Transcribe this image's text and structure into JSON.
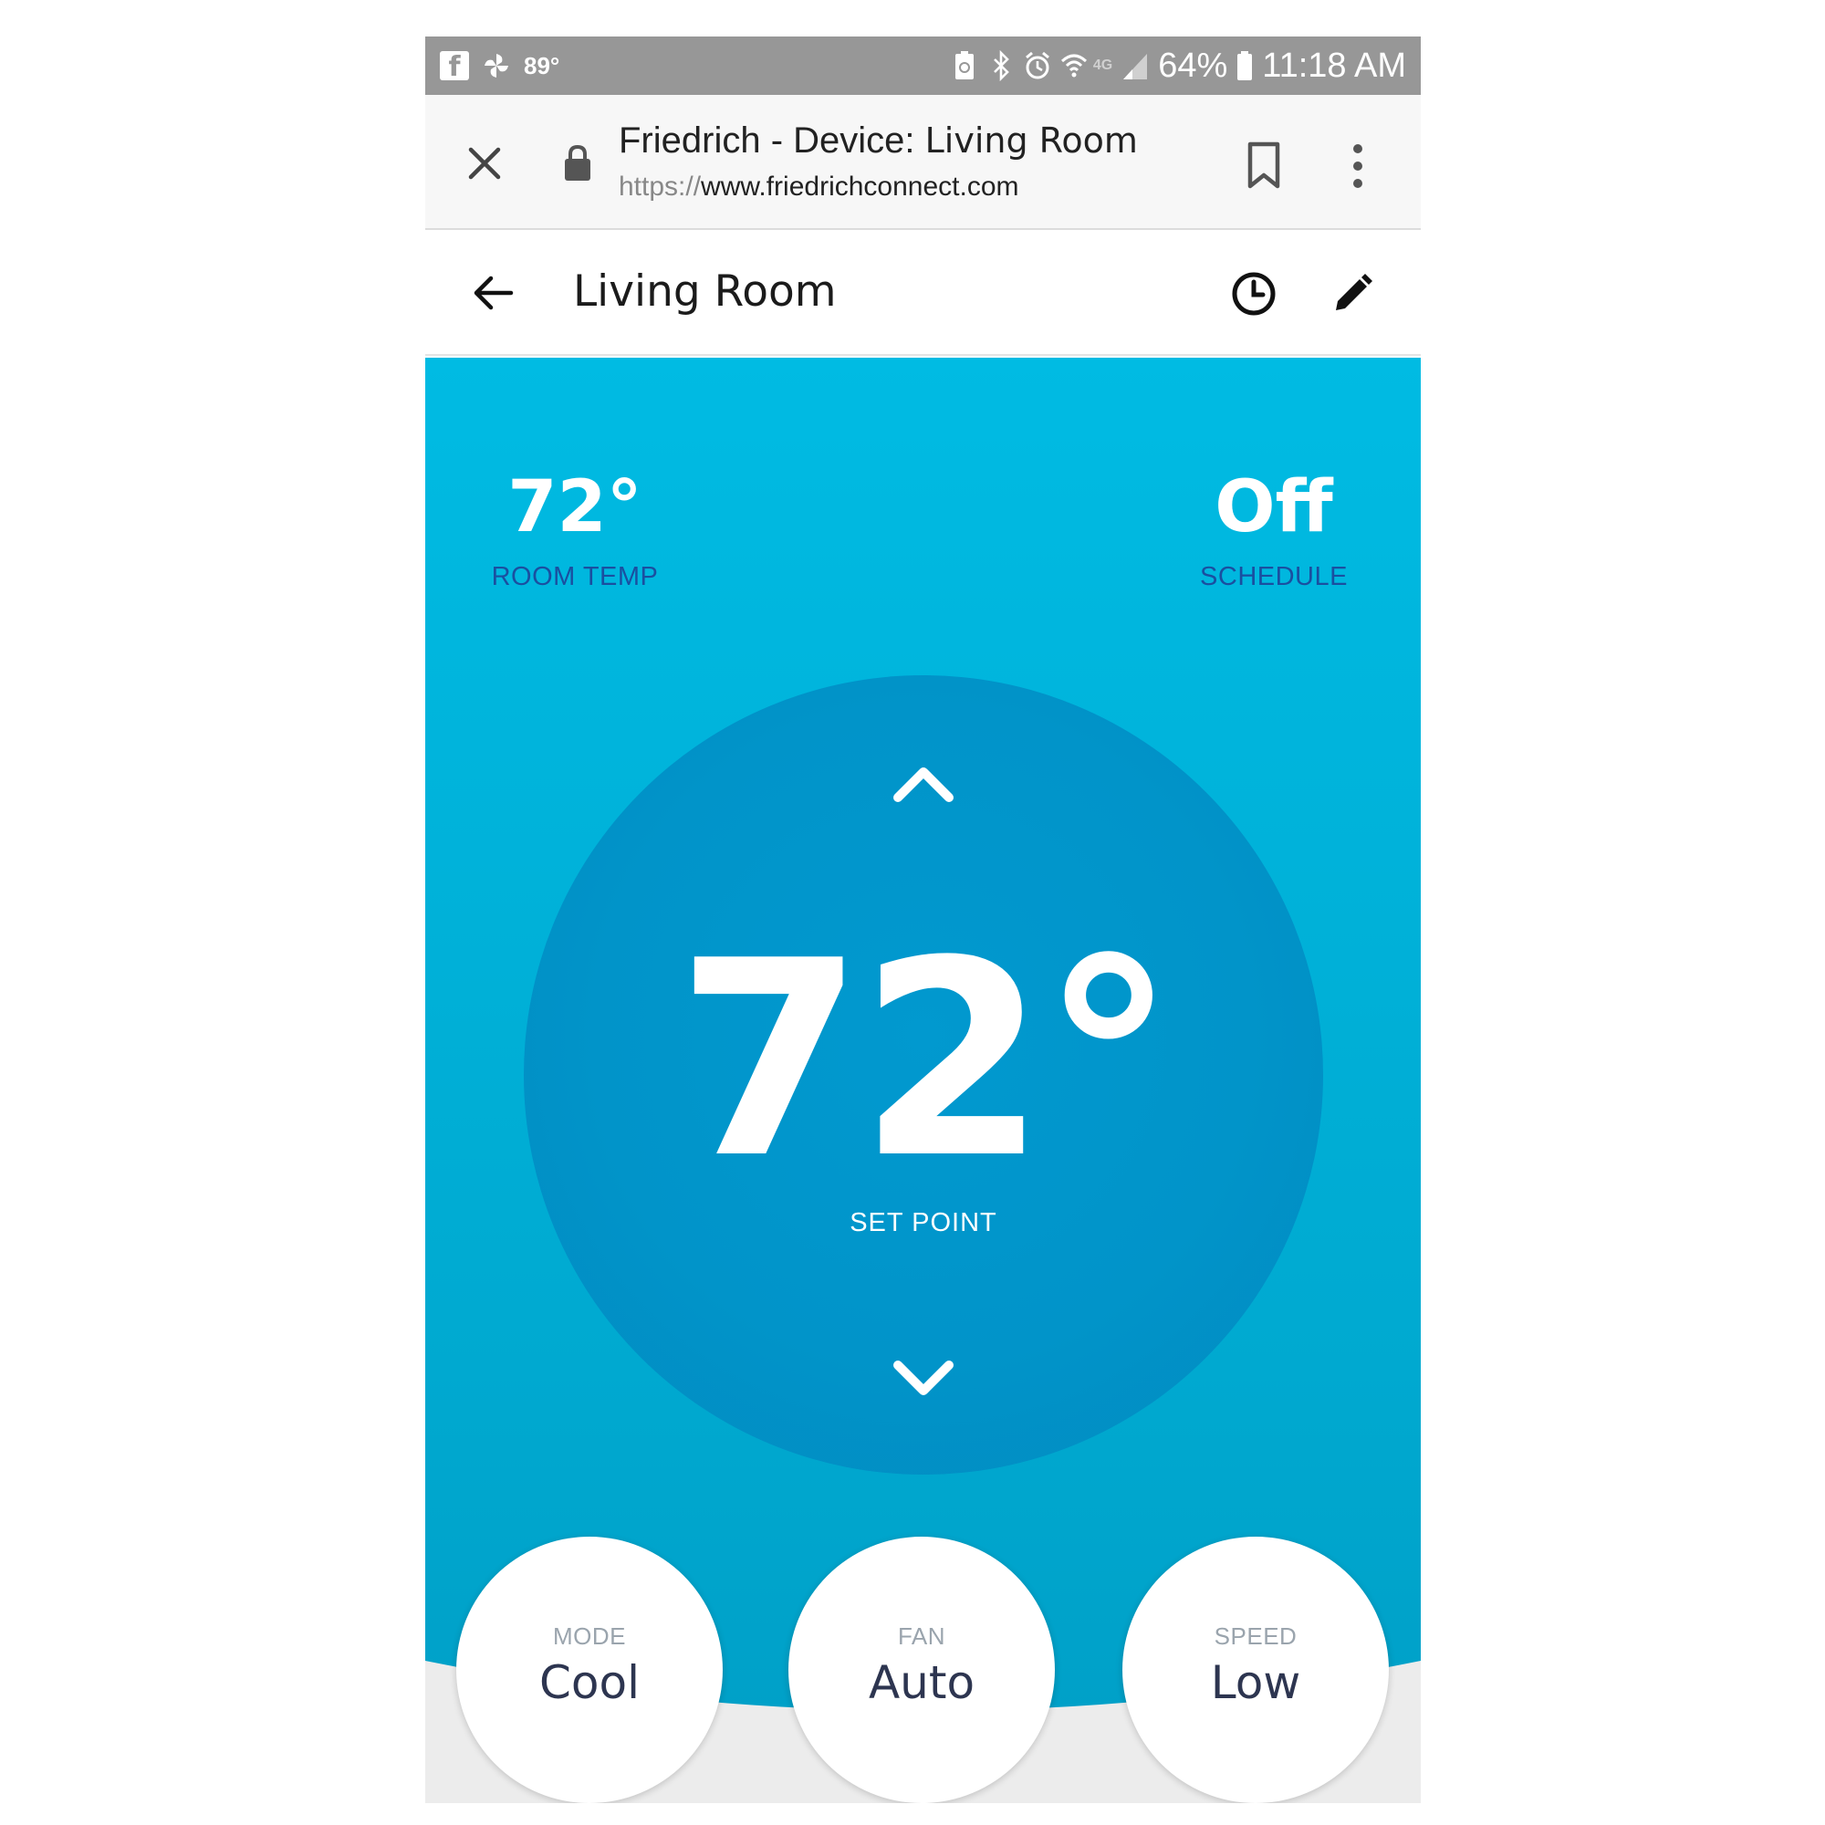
{
  "status_bar": {
    "weather": "89°",
    "network": "4G",
    "battery": "64%",
    "time": "11:18 AM"
  },
  "browser": {
    "title_prefix": "Friedrich - Device: ",
    "title_device": "Living Room",
    "url_scheme": "https://",
    "url_host": "www.friedrichconnect.com"
  },
  "header": {
    "title": "Living Room"
  },
  "stats": {
    "room_temp_value": "72°",
    "room_temp_label": "ROOM TEMP",
    "schedule_value": "Off",
    "schedule_label": "SCHEDULE"
  },
  "dial": {
    "setpoint_value": "72°",
    "setpoint_label": "SET POINT"
  },
  "controls": {
    "mode_label": "MODE",
    "mode_value": "Cool",
    "fan_label": "FAN",
    "fan_value": "Auto",
    "speed_label": "SPEED",
    "speed_value": "Low"
  },
  "colors": {
    "main_top": "#00bbe3",
    "main_bottom": "#009ec6",
    "dial": "#0194c9",
    "stat_label": "#1a4fa0",
    "control_text": "#2d3550",
    "status_bar": "#979797"
  },
  "icons": {
    "status_left": [
      "facebook-icon",
      "pinwheel-icon"
    ],
    "status_right": [
      "battery-saver-icon",
      "bluetooth-icon",
      "alarm-icon",
      "wifi-icon",
      "signal-icon",
      "battery-icon"
    ],
    "browser": [
      "close-icon",
      "lock-icon",
      "bookmark-icon",
      "more-vert-icon"
    ],
    "header": [
      "back-arrow-icon",
      "clock-icon",
      "edit-pencil-icon"
    ],
    "dial": [
      "chevron-up-icon",
      "chevron-down-icon"
    ]
  }
}
